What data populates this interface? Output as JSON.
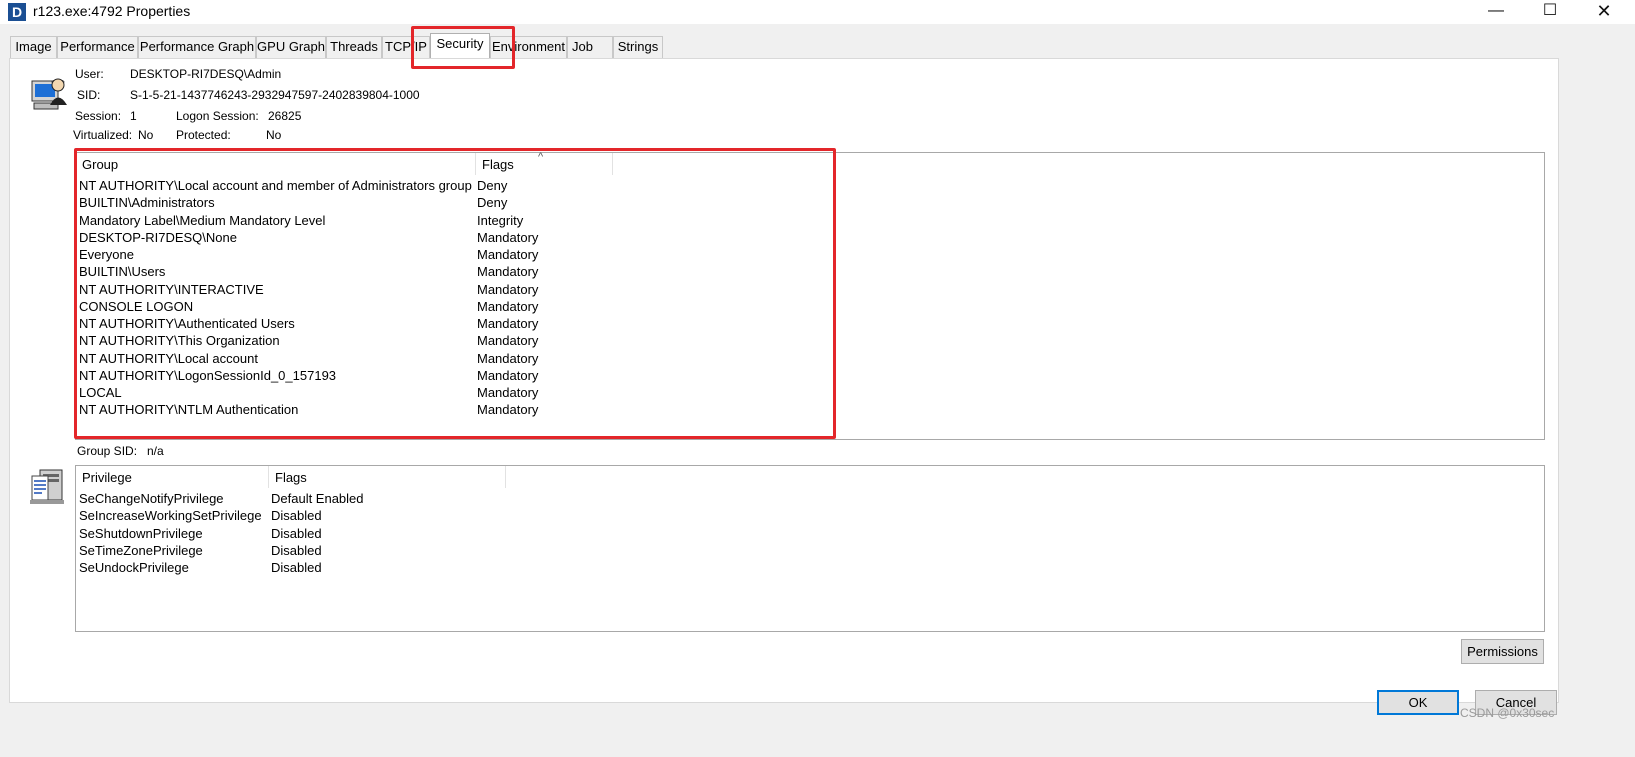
{
  "window": {
    "app_icon_letter": "D",
    "title": "r123.exe:4792 Properties",
    "min_glyph": "—",
    "max_glyph": "☐",
    "close_glyph": "✕"
  },
  "tabs": [
    {
      "label": "Image"
    },
    {
      "label": "Performance"
    },
    {
      "label": "Performance Graph"
    },
    {
      "label": "GPU Graph"
    },
    {
      "label": "Threads"
    },
    {
      "label": "TCP/IP"
    },
    {
      "label": "Security",
      "active": true
    },
    {
      "label": "Environment"
    },
    {
      "label": "Job"
    },
    {
      "label": "Strings"
    }
  ],
  "security": {
    "user_label": "User:",
    "user_value": "DESKTOP-RI7DESQ\\Admin",
    "sid_label": "SID:",
    "sid_value": "S-1-5-21-1437746243-2932947597-2402839804-1000",
    "session_label": "Session:",
    "session_value": "1",
    "logon_session_label": "Logon Session:",
    "logon_session_value": "26825",
    "virtualized_label": "Virtualized:",
    "virtualized_value": "No",
    "protected_label": "Protected:",
    "protected_value": "No"
  },
  "groups": {
    "columns": [
      "Group",
      "Flags"
    ],
    "sort_indicator": "^",
    "rows": [
      {
        "group": "NT AUTHORITY\\Local account and member of Administrators group",
        "flags": "Deny"
      },
      {
        "group": "BUILTIN\\Administrators",
        "flags": "Deny"
      },
      {
        "group": "Mandatory Label\\Medium Mandatory Level",
        "flags": "Integrity"
      },
      {
        "group": "DESKTOP-RI7DESQ\\None",
        "flags": "Mandatory"
      },
      {
        "group": "Everyone",
        "flags": "Mandatory"
      },
      {
        "group": "BUILTIN\\Users",
        "flags": "Mandatory"
      },
      {
        "group": "NT AUTHORITY\\INTERACTIVE",
        "flags": "Mandatory"
      },
      {
        "group": "CONSOLE LOGON",
        "flags": "Mandatory"
      },
      {
        "group": "NT AUTHORITY\\Authenticated Users",
        "flags": "Mandatory"
      },
      {
        "group": "NT AUTHORITY\\This Organization",
        "flags": "Mandatory"
      },
      {
        "group": "NT AUTHORITY\\Local account",
        "flags": "Mandatory"
      },
      {
        "group": "NT AUTHORITY\\LogonSessionId_0_157193",
        "flags": "Mandatory"
      },
      {
        "group": "LOCAL",
        "flags": "Mandatory"
      },
      {
        "group": "NT AUTHORITY\\NTLM Authentication",
        "flags": "Mandatory"
      }
    ]
  },
  "group_sid": {
    "label": "Group SID:",
    "value": "n/a"
  },
  "privileges": {
    "columns": [
      "Privilege",
      "Flags"
    ],
    "rows": [
      {
        "privilege": "SeChangeNotifyPrivilege",
        "flags": "Default Enabled"
      },
      {
        "privilege": "SeIncreaseWorkingSetPrivilege",
        "flags": "Disabled"
      },
      {
        "privilege": "SeShutdownPrivilege",
        "flags": "Disabled"
      },
      {
        "privilege": "SeTimeZonePrivilege",
        "flags": "Disabled"
      },
      {
        "privilege": "SeUndockPrivilege",
        "flags": "Disabled"
      }
    ]
  },
  "buttons": {
    "permissions": "Permissions",
    "ok": "OK",
    "cancel": "Cancel"
  },
  "watermark": "CSDN @0x30sec",
  "colors": {
    "highlight_red": "#e3262a",
    "focus_blue": "#0078d7"
  }
}
